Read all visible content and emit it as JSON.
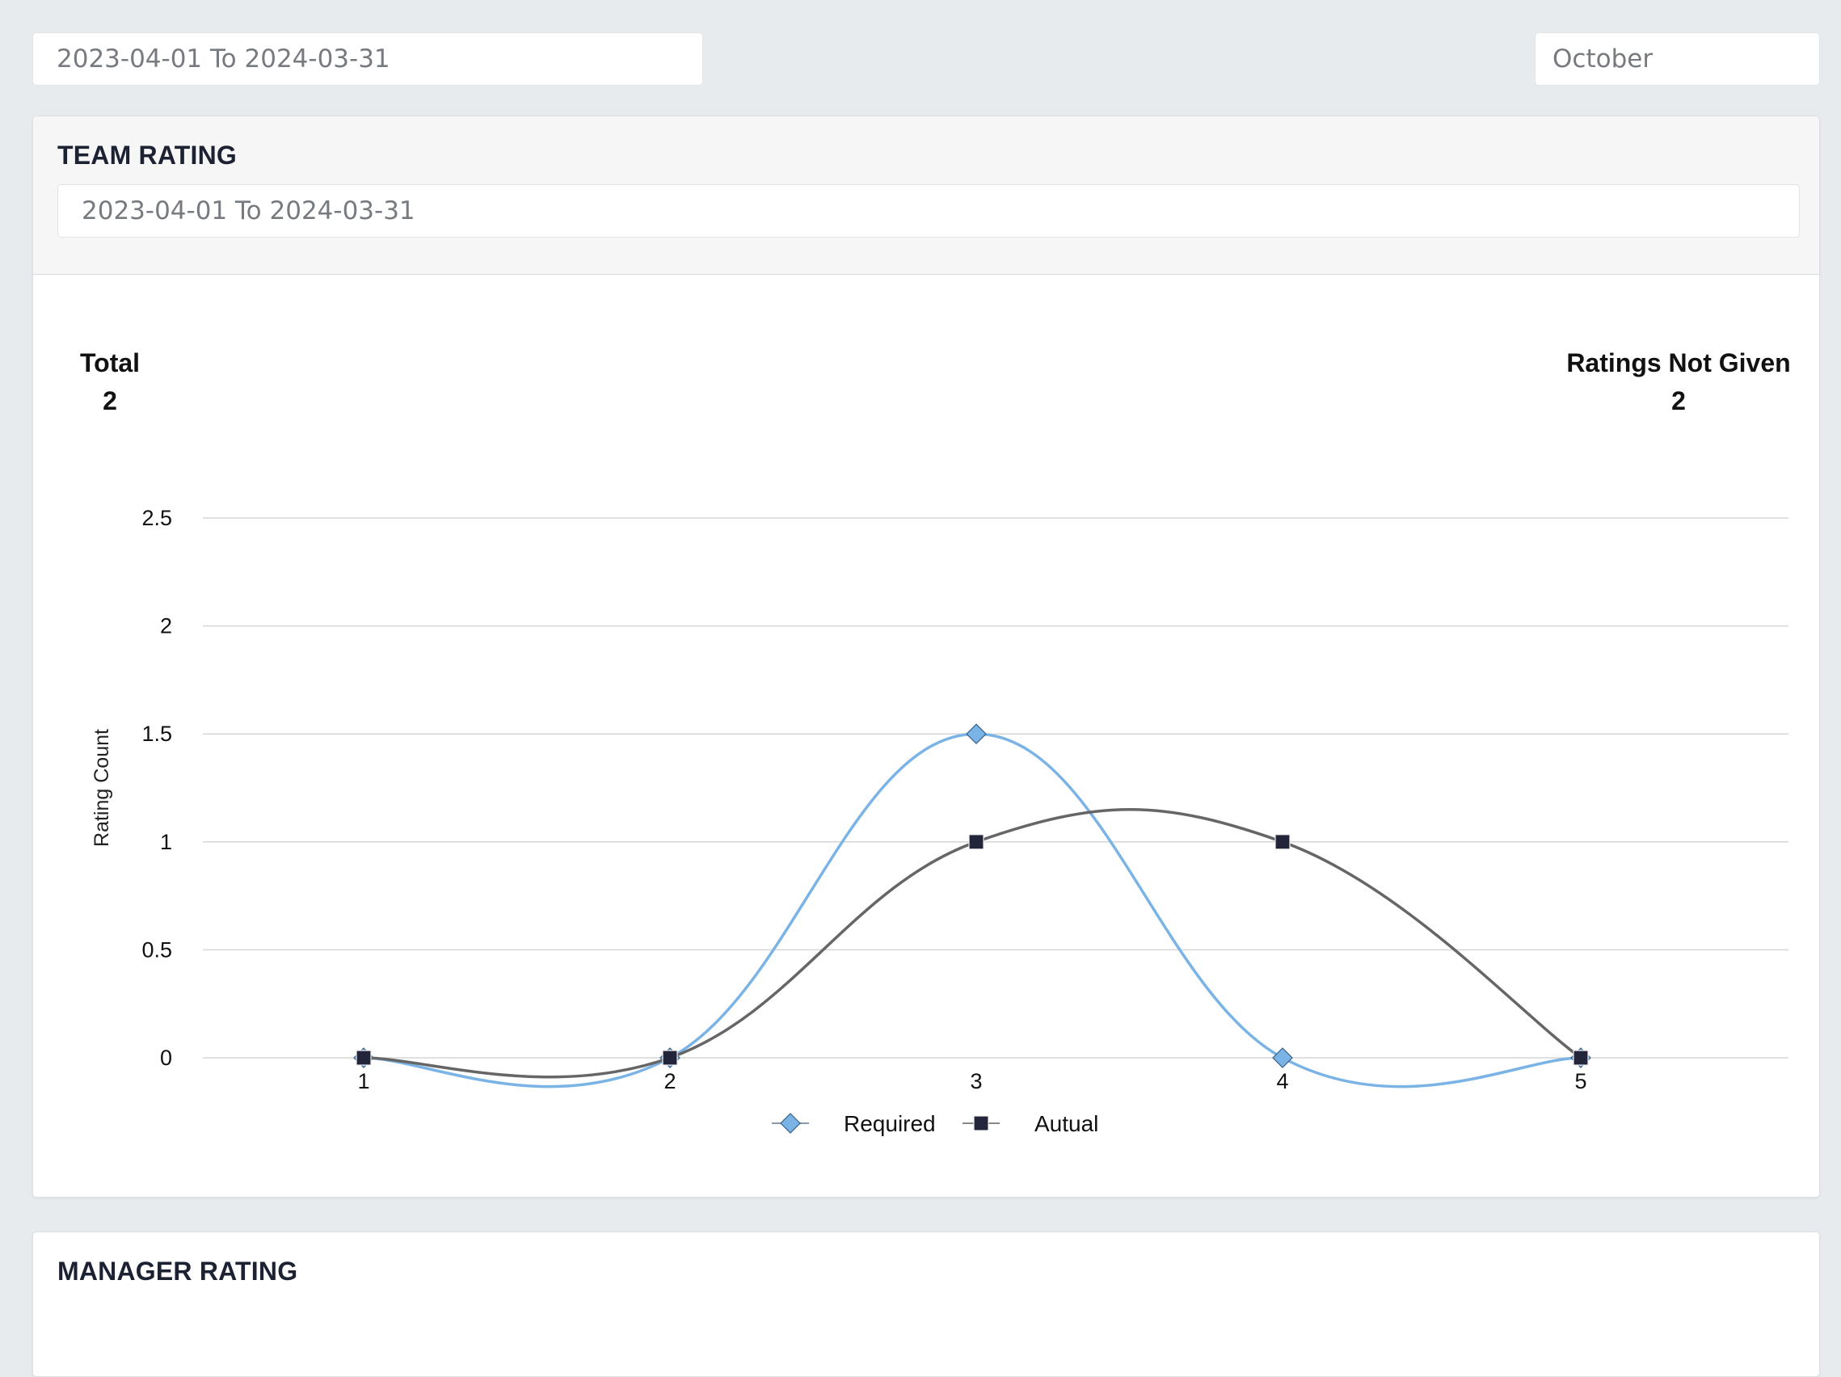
{
  "filters": {
    "date_range": "2023-04-01 To 2024-03-31",
    "month": "October"
  },
  "team_rating": {
    "title": "TEAM RATING",
    "date_range": "2023-04-01 To 2024-03-31",
    "total_label": "Total",
    "total_value": "2",
    "not_given_label": "Ratings Not Given",
    "not_given_value": "2"
  },
  "manager_rating": {
    "title": "MANAGER RATING"
  },
  "colors": {
    "required": "#7ab3e6",
    "actual": "#666666",
    "actual_marker": "#23253b",
    "grid": "#d6d6d6"
  },
  "chart_data": {
    "type": "line",
    "smooth": true,
    "x": [
      1,
      2,
      3,
      4,
      5
    ],
    "ylabel": "Rating Count",
    "ylim": [
      0,
      2.5
    ],
    "yticks": [
      "0",
      "0.5",
      "1",
      "1.5",
      "2",
      "2.5"
    ],
    "xticks": [
      "1",
      "2",
      "3",
      "4",
      "5"
    ],
    "legend_position": "bottom",
    "grid": true,
    "series": [
      {
        "name": "Required",
        "marker": "diamond",
        "values": [
          0,
          0,
          1.5,
          0,
          0
        ]
      },
      {
        "name": "Autual",
        "marker": "square",
        "values": [
          0,
          0,
          1,
          1,
          0
        ]
      }
    ]
  }
}
